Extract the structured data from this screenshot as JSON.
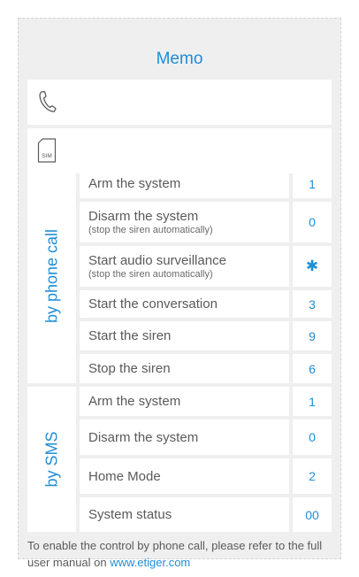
{
  "title": "Memo",
  "icons": {
    "phone": "phone-icon",
    "sim": "sim-card-icon"
  },
  "sim_label": "SIM",
  "colors": {
    "accent": "#1e8ed6",
    "text": "#5a5a5a",
    "background": "#efeff0"
  },
  "phone_call": {
    "label": "by phone call",
    "rows": [
      {
        "text": "Arm the system",
        "sub": "",
        "value": "1"
      },
      {
        "text": "Disarm the system",
        "sub": "(stop the siren automatically)",
        "value": "0"
      },
      {
        "text": "Start audio surveillance",
        "sub": "(stop the siren automatically)",
        "value": "✱"
      },
      {
        "text": "Start the conversation",
        "sub": "",
        "value": "3"
      },
      {
        "text": "Start the siren",
        "sub": "",
        "value": "9"
      },
      {
        "text": "Stop the siren",
        "sub": "",
        "value": "6"
      }
    ]
  },
  "sms": {
    "label": "by SMS",
    "rows": [
      {
        "text": "Arm the system",
        "sub": "",
        "value": "1"
      },
      {
        "text": "Disarm the system",
        "sub": "",
        "value": "0"
      },
      {
        "text": "Home Mode",
        "sub": "",
        "value": "2"
      },
      {
        "text": "System status",
        "sub": "",
        "value": "00"
      }
    ]
  },
  "footer": {
    "text": "To enable the control by phone call, please refer to the full user manual on ",
    "link": "www.etiger.com"
  }
}
